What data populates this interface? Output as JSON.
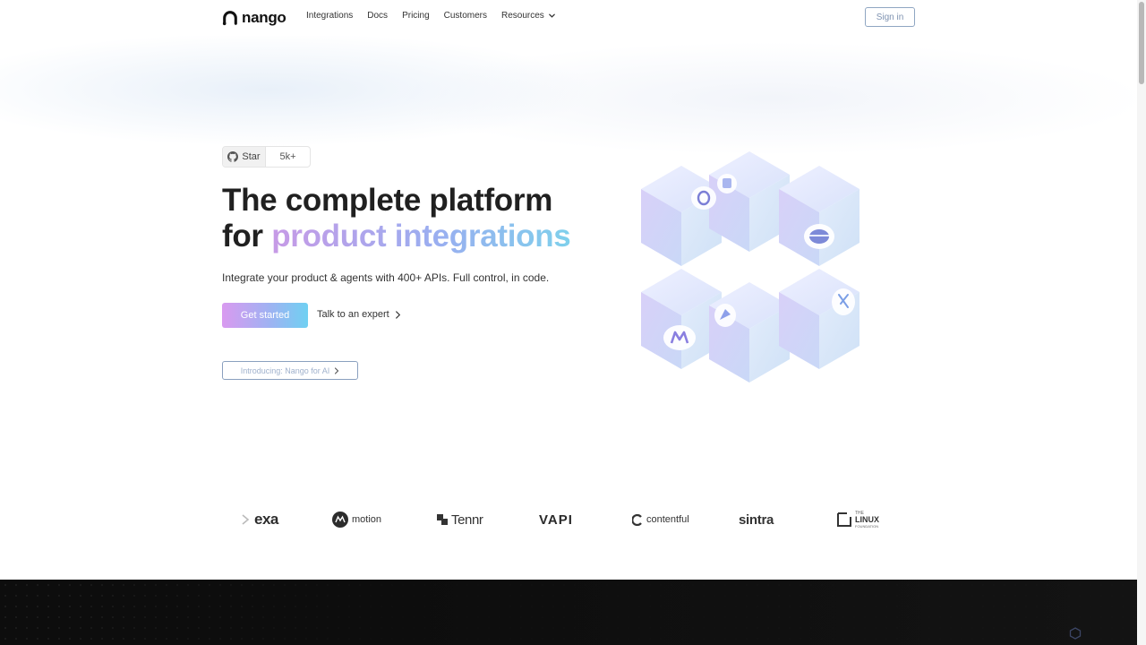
{
  "nav": {
    "logo_text": "nango",
    "links": [
      {
        "label": "Integrations"
      },
      {
        "label": "Docs"
      },
      {
        "label": "Pricing"
      },
      {
        "label": "Customers"
      },
      {
        "label": "Resources"
      }
    ],
    "signin_label": "Sign in"
  },
  "hero": {
    "star_label": "Star",
    "star_count": "5k+",
    "headline_line1": "The complete platform",
    "headline_for": "for ",
    "headline_gradient": "product integrations",
    "subtitle": "Integrate your product & agents with 400+ APIs. Full control, in code.",
    "cta_label": "Get started",
    "expert_label": "Talk to an expert",
    "ai_pill_label": "Introducing: Nango for AI"
  },
  "logos": [
    {
      "name": "exa",
      "text": "exa"
    },
    {
      "name": "motion",
      "text": "motion"
    },
    {
      "name": "tennr",
      "text": "Tennr"
    },
    {
      "name": "vapi",
      "text": "VAPI"
    },
    {
      "name": "contentful",
      "text": "contentful"
    },
    {
      "name": "sintra",
      "text": "sintra"
    },
    {
      "name": "linux-foundation",
      "text": "LINUX",
      "small": "THE",
      "sub": "FOUNDATION"
    }
  ],
  "colors": {
    "brand_gradient_start": "#d99af0",
    "brand_gradient_mid": "#9fb2f2",
    "brand_gradient_end": "#6fd0f2",
    "outline_blue": "#8fa6c2",
    "dark_band": "#0d0d0d"
  },
  "icons": {
    "logo": "nango-logo-icon",
    "github": "github-icon",
    "resources_dropdown": "chevron-down-icon",
    "expert_arrow": "chevron-right-icon",
    "ai_arrow": "chevron-right-icon"
  }
}
